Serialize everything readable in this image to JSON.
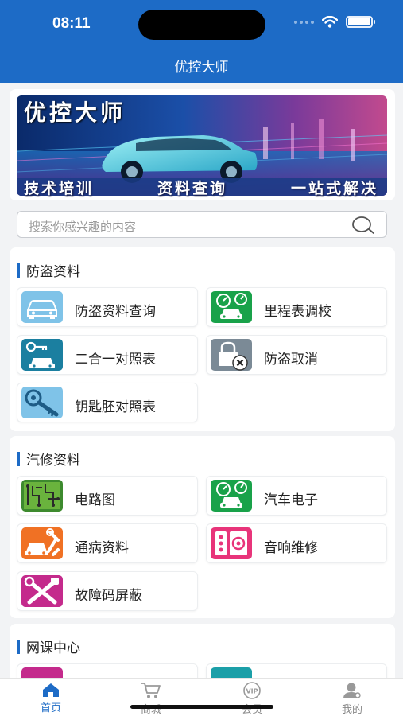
{
  "status_bar": {
    "time": "08:11"
  },
  "nav": {
    "title": "优控大师"
  },
  "banner": {
    "title": "优控大师",
    "tagline": [
      "技术培训",
      "资料查询",
      "一站式解决"
    ]
  },
  "search": {
    "placeholder": "搜索你感兴趣的内容"
  },
  "sections": [
    {
      "title": "防盗资料",
      "items": [
        {
          "label": "防盗资料查询",
          "icon": "car-outline-icon"
        },
        {
          "label": "里程表调校",
          "icon": "odometer-car-icon"
        },
        {
          "label": "二合一对照表",
          "icon": "key-car-icon"
        },
        {
          "label": "防盗取消",
          "icon": "lock-cancel-icon"
        },
        {
          "label": "钥匙胚对照表",
          "icon": "key-icon"
        }
      ]
    },
    {
      "title": "汽修资料",
      "items": [
        {
          "label": "电路图",
          "icon": "circuit-board-icon"
        },
        {
          "label": "汽车电子",
          "icon": "odometer-car-icon"
        },
        {
          "label": "通病资料",
          "icon": "wrench-car-icon"
        },
        {
          "label": "音响维修",
          "icon": "speaker-icon"
        },
        {
          "label": "故障码屏蔽",
          "icon": "tools-cross-icon"
        }
      ]
    },
    {
      "title": "网课中心",
      "items": []
    }
  ],
  "tabbar": [
    {
      "label": "首页",
      "icon": "home-icon",
      "active": true
    },
    {
      "label": "商城",
      "icon": "cart-icon",
      "active": false
    },
    {
      "label": "会员",
      "icon": "vip-icon",
      "active": false
    },
    {
      "label": "我的",
      "icon": "user-icon",
      "active": false
    }
  ],
  "colors": {
    "brand_blue": "#1d6bc6",
    "green": "#19a24a",
    "orange": "#f07124",
    "pink": "#e8347a",
    "magenta": "#c42a8c",
    "teal": "#1b7fa0",
    "light_blue": "#7fc3e8"
  }
}
